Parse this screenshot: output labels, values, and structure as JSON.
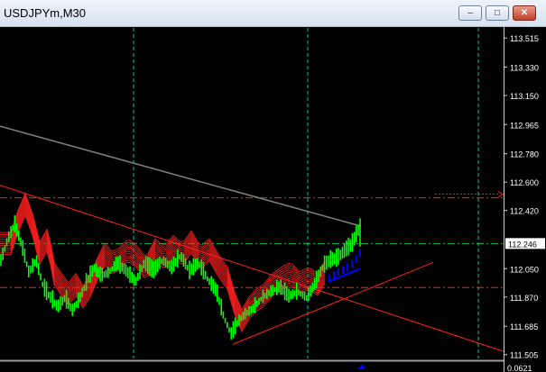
{
  "window": {
    "title": "USDJPYm,M30",
    "buttons": {
      "minimize": "–",
      "maximize": "□",
      "close": "✕"
    }
  },
  "colors": {
    "background": "#000000",
    "price": "#00ff00",
    "ribbon": "#ff2020",
    "ma_slow": "#808080",
    "trend": "#ff2020",
    "grid": "#00c8a0",
    "level_red": "#ff2020",
    "level_green": "#00c060",
    "ask_label_bg": "#ffffff",
    "blue": "#0000ff"
  },
  "price_axis": {
    "labels": [
      "113.515",
      "113.330",
      "113.150",
      "112.965",
      "112.780",
      "112.600",
      "112.420",
      "112.246",
      "112.050",
      "111.870",
      "111.685",
      "111.505",
      "0.0621"
    ],
    "current_price": "112.246"
  },
  "chart_data": {
    "type": "line",
    "title": "USDJPYm,M30",
    "ylim": [
      111.48,
      113.55
    ],
    "levels": {
      "red_upper": 112.5,
      "green_current": 112.21,
      "red_lower": 111.93
    },
    "slow_ma": {
      "x": [
        0,
        400
      ],
      "y": [
        112.955,
        112.32
      ]
    },
    "trendlines": [
      {
        "x": [
          0,
          558
        ],
        "y": [
          112.58,
          111.525
        ]
      },
      {
        "x": [
          258,
          480
        ],
        "y": [
          111.57,
          112.09
        ]
      }
    ],
    "price_path": [
      [
        0,
        112.08
      ],
      [
        8,
        112.22
      ],
      [
        16,
        112.33
      ],
      [
        24,
        112.2
      ],
      [
        32,
        112.02
      ],
      [
        40,
        112.1
      ],
      [
        48,
        111.93
      ],
      [
        56,
        111.86
      ],
      [
        64,
        111.8
      ],
      [
        72,
        111.86
      ],
      [
        80,
        111.78
      ],
      [
        88,
        111.85
      ],
      [
        96,
        111.96
      ],
      [
        104,
        112.05
      ],
      [
        112,
        112.0
      ],
      [
        120,
        112.02
      ],
      [
        130,
        112.08
      ],
      [
        140,
        112.03
      ],
      [
        150,
        111.96
      ],
      [
        160,
        112.08
      ],
      [
        170,
        112.03
      ],
      [
        180,
        112.1
      ],
      [
        190,
        112.05
      ],
      [
        200,
        112.13
      ],
      [
        210,
        112.03
      ],
      [
        220,
        112.08
      ],
      [
        230,
        111.98
      ],
      [
        240,
        111.9
      ],
      [
        248,
        111.74
      ],
      [
        256,
        111.63
      ],
      [
        264,
        111.71
      ],
      [
        272,
        111.76
      ],
      [
        280,
        111.79
      ],
      [
        290,
        111.86
      ],
      [
        300,
        111.9
      ],
      [
        310,
        111.93
      ],
      [
        320,
        111.87
      ],
      [
        330,
        111.9
      ],
      [
        340,
        111.86
      ],
      [
        350,
        111.96
      ],
      [
        358,
        112.06
      ],
      [
        366,
        112.1
      ],
      [
        374,
        112.11
      ],
      [
        382,
        112.16
      ],
      [
        390,
        112.2
      ],
      [
        398,
        112.3
      ]
    ],
    "blue_fan": [
      [
        365,
        111.98
      ],
      [
        370,
        112.0
      ],
      [
        375,
        112.02
      ],
      [
        380,
        112.03
      ],
      [
        385,
        112.05
      ],
      [
        390,
        112.07
      ],
      [
        395,
        112.1
      ],
      [
        399,
        112.14
      ]
    ]
  }
}
